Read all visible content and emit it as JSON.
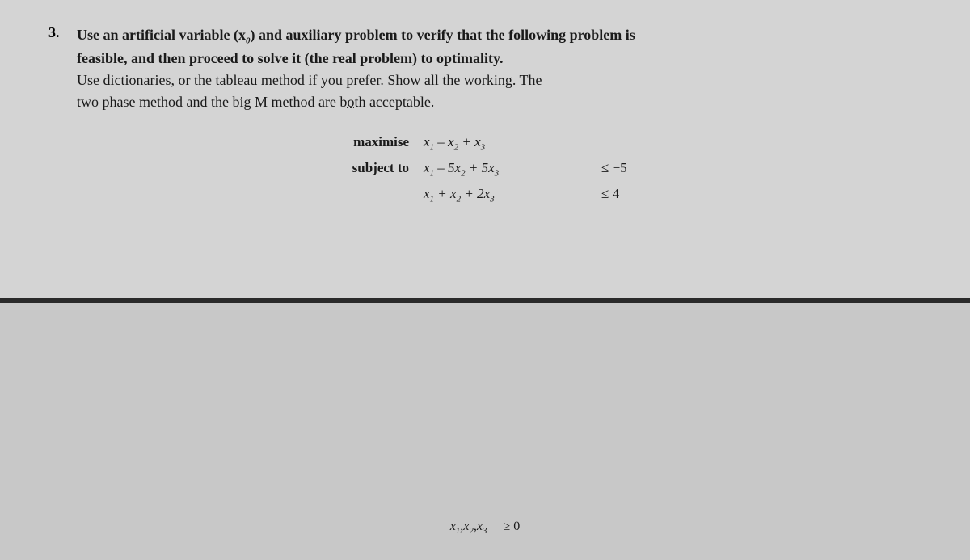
{
  "page": {
    "background_color": "#c8c8c8",
    "content_background": "#d4d4d4"
  },
  "question": {
    "number": "3.",
    "lines": [
      "Use an artificial variable (x₀) and auxiliary problem to verify that the following problem is",
      "feasible, and then proceed to solve it (the real problem) to optimality.",
      "Use dictionaries, or the tableau method if you prefer. Show all the working. The",
      "two phase method and the big M method are both acceptable."
    ]
  },
  "math": {
    "maximise_label": "maximise",
    "maximise_expr": "x₁ – x₂ + x₃",
    "subject_to_label": "subject to",
    "constraint1_expr": "x₁ – 5x₂ + 5x₃",
    "constraint1_ineq": "≤ −5",
    "constraint2_expr": "x₁ + x₂ + 2x₃",
    "constraint2_ineq": "≤ 4",
    "nonnegativity_expr": "x₁, x₂, x₃",
    "nonnegativity_ineq": "≥ 0"
  }
}
